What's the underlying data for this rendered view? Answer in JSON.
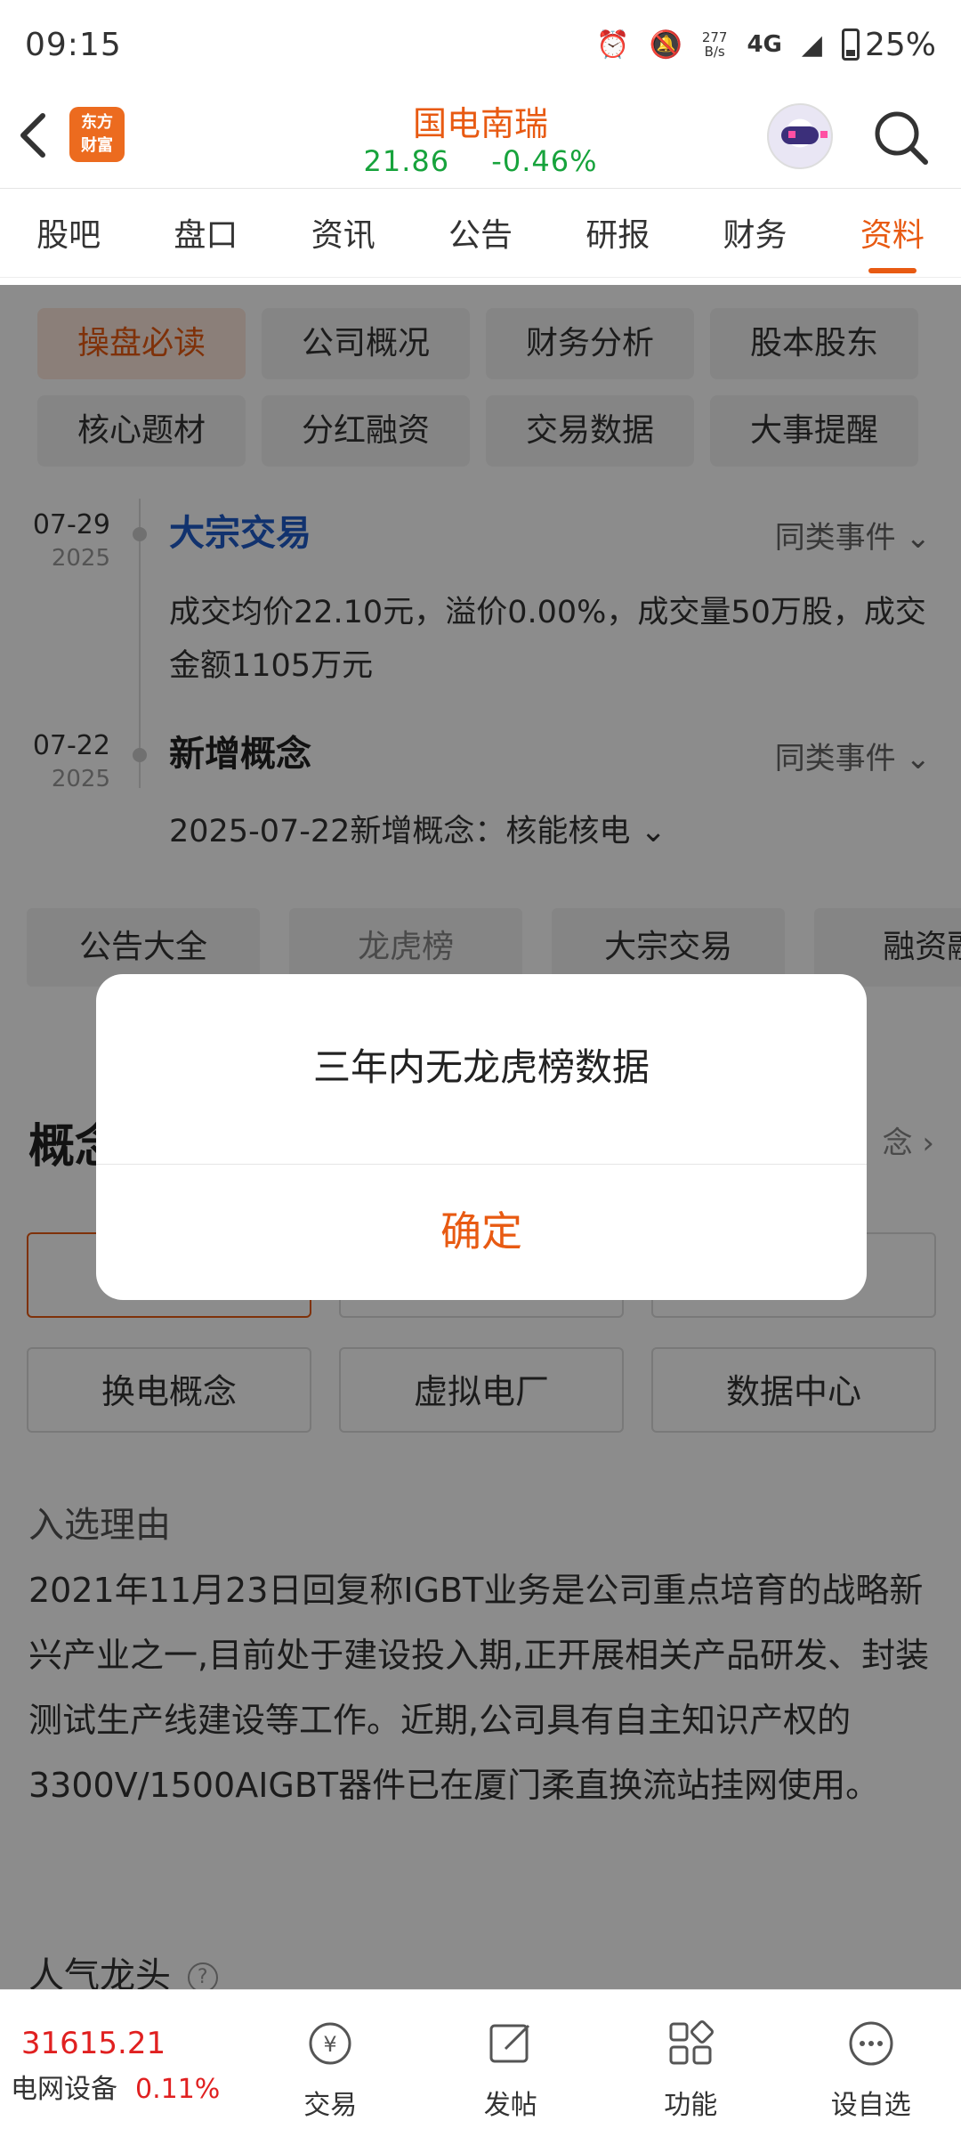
{
  "status_bar": {
    "time": "09:15",
    "net_speed": "277\nB/s",
    "network": "4G",
    "battery": "25%"
  },
  "header": {
    "stock_name": "国电南瑞",
    "price": "21.86",
    "change_pct": "-0.46%",
    "logo_text": "东方\n财富"
  },
  "tabs": [
    {
      "label": "股吧"
    },
    {
      "label": "盘口"
    },
    {
      "label": "资讯"
    },
    {
      "label": "公告"
    },
    {
      "label": "研报"
    },
    {
      "label": "财务"
    },
    {
      "label": "资料",
      "active": true
    }
  ],
  "subcategories": [
    {
      "label": "操盘必读",
      "active": true
    },
    {
      "label": "公司概况"
    },
    {
      "label": "财务分析"
    },
    {
      "label": "股本股东"
    },
    {
      "label": "核心题材"
    },
    {
      "label": "分红融资"
    },
    {
      "label": "交易数据"
    },
    {
      "label": "大事提醒"
    }
  ],
  "events": [
    {
      "date": "07-29",
      "year": "2025",
      "title": "大宗交易",
      "more": "同类事件",
      "body": "成交均价22.10元，溢价0.00%，成交量50万股，成交金额1105万元"
    },
    {
      "date": "07-22",
      "year": "2025",
      "title": "新增概念",
      "more": "同类事件",
      "body": "2025-07-22新增概念：核能核电"
    }
  ],
  "quick_links": [
    {
      "label": "公告大全"
    },
    {
      "label": "龙虎榜"
    },
    {
      "label": "大宗交易"
    },
    {
      "label": "融资融"
    }
  ],
  "concept": {
    "title": "概念",
    "more": "念",
    "buttons": [
      {
        "label": ""
      },
      {
        "label": ""
      },
      {
        "label": ""
      },
      {
        "label": "换电概念"
      },
      {
        "label": "虚拟电厂"
      },
      {
        "label": "数据中心"
      }
    ],
    "reason_title": "入选理由",
    "reason_text": "2021年11月23日回复称IGBT业务是公司重点培育的战略新兴产业之一,目前处于建设投入期,正开展相关产品研发、封装测试生产线建设等工作。近期,公司具有自主知识产权的3300V/1500AIGBT器件已在厦门柔直换流站挂网使用。",
    "popular_title": "人气龙头"
  },
  "bottom_bar": {
    "index_value": "31615.21",
    "index_name": "电网设备",
    "index_change": "0.11%",
    "items": [
      {
        "label": "交易",
        "icon": "trade-icon"
      },
      {
        "label": "发帖",
        "icon": "post-icon"
      },
      {
        "label": "功能",
        "icon": "apps-icon"
      },
      {
        "label": "设自选",
        "icon": "more-icon"
      }
    ]
  },
  "dialog": {
    "message": "三年内无龙虎榜数据",
    "confirm": "确定"
  },
  "colors": {
    "accent": "#e85a12",
    "down_green": "#17a33c",
    "up_red": "#e02020",
    "link_blue": "#1f5cc9"
  }
}
